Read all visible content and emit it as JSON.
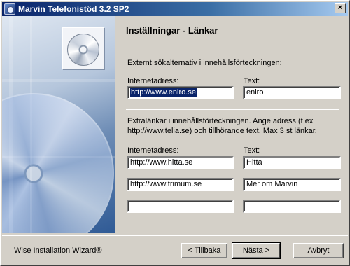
{
  "window": {
    "title": "Marvin Telefonistöd 3.2 SP2",
    "close_glyph": "×"
  },
  "page": {
    "heading": "Inställningar - Länkar"
  },
  "search_section": {
    "description": "Externt sökalternativ i innehållsförteckningen:",
    "url_label": "Internetadress:",
    "text_label": "Text:",
    "url_value": "http://www.eniro.se",
    "text_value": "eniro"
  },
  "extra_section": {
    "description": "Extralänkar i innehållsförteckningen.  Ange adress (t ex http://www.telia.se) och tillhörande text. Max 3 st länkar.",
    "url_label": "Internetadress:",
    "text_label": "Text:",
    "links": [
      {
        "url": "http://www.hitta.se",
        "text": "Hitta"
      },
      {
        "url": "http://www.trimum.se",
        "text": "Mer om Marvin"
      },
      {
        "url": "",
        "text": ""
      }
    ]
  },
  "footer": {
    "brand": "Wise Installation Wizard®",
    "back_label": "< Tillbaka",
    "next_label": "Nästa >",
    "cancel_label": "Avbryt"
  }
}
